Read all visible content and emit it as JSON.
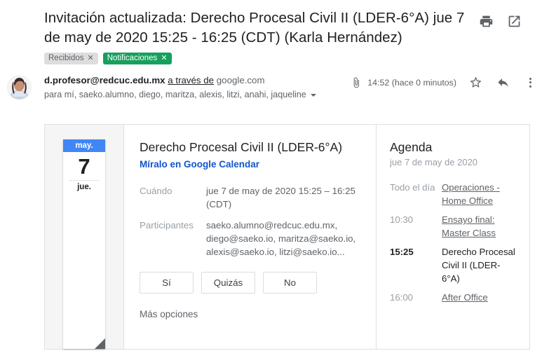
{
  "header": {
    "subject": "Invitación actualizada: Derecho Procesal Civil II (LDER-6°A) jue 7 de may de 2020 15:25 - 16:25 (CDT) (Karla Hernández)",
    "print_icon": "printer-icon",
    "popout_icon": "open-in-new-window-icon"
  },
  "labels": [
    {
      "text": "Recibidos",
      "remove": "✕",
      "color": "#ddddde",
      "style": "grey"
    },
    {
      "text": "Notificaciones",
      "remove": "✕",
      "color": "#16a05d",
      "style": "green"
    }
  ],
  "sender": {
    "email": "d.profesor@redcuc.edu.mx",
    "via": "a través de",
    "via_domain": "google.com",
    "recipients": "para mí, saeko.alumno, diego, maritza, alexis, litzi, anahi, jaqueline",
    "attachment_icon": "paperclip-icon",
    "timestamp": "14:52 (hace 0 minutos)",
    "star_icon": "star-icon",
    "reply_icon": "reply-arrow-icon",
    "more_icon": "more-vertical-icon"
  },
  "invite": {
    "date_tile": {
      "month": "may.",
      "day_number": "7",
      "weekday": "jue.",
      "header_color": "#4285f4"
    },
    "title": "Derecho Procesal Civil II (LDER-6°A)",
    "calendar_link": "Míralo en Google Calendar",
    "link_color": "#1155cc",
    "details": [
      {
        "label": "Cuándo",
        "value": "jue 7 de may de 2020 15:25 – 16:25 (CDT)"
      },
      {
        "label": "Participantes",
        "value": "saeko.alumno@redcuc.edu.mx, diego@saeko.io, maritza@saeko.io, alexis@saeko.io, litzi@saeko.io..."
      }
    ],
    "rsvp": [
      {
        "label": "Sí"
      },
      {
        "label": "Quizás"
      },
      {
        "label": "No"
      }
    ],
    "more_options": "Más opciones"
  },
  "agenda": {
    "title": "Agenda",
    "date": "jue 7 de may de 2020",
    "entries": [
      {
        "time": "Todo el día",
        "name": "Operaciones - Home Office",
        "current": false
      },
      {
        "time": "10:30",
        "name": "Ensayo final: Master Class",
        "current": false
      },
      {
        "time": "15:25",
        "name": "Derecho Procesal Civil II (LDER-6°A)",
        "current": true
      },
      {
        "time": "16:00",
        "name": "After Office",
        "current": false
      }
    ]
  }
}
